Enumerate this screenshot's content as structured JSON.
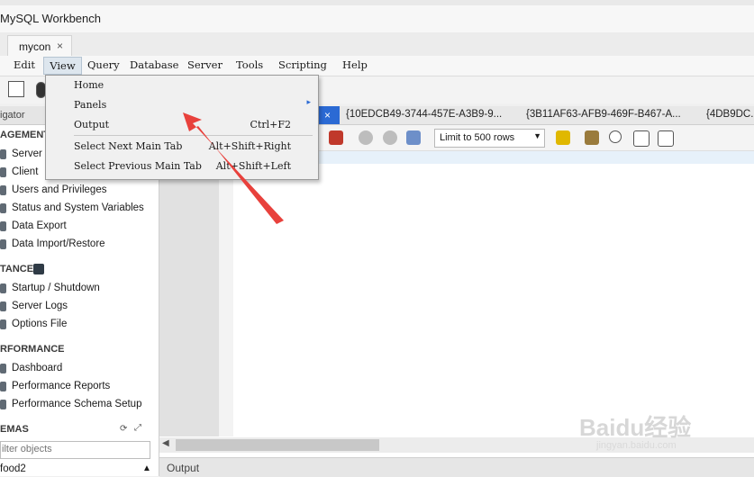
{
  "app": {
    "title": "MySQL Workbench",
    "connection_tab": "mycon",
    "close_glyph": "×"
  },
  "menubar": {
    "items": [
      "Edit",
      "View",
      "Query",
      "Database",
      "Server",
      "Tools",
      "Scripting",
      "Help"
    ],
    "active": "View"
  },
  "view_menu": {
    "items": [
      {
        "label": "Home",
        "shortcut": ""
      },
      {
        "label": "Panels",
        "shortcut": "",
        "submenu": "▸"
      },
      {
        "label": "Output",
        "shortcut": "Ctrl+F2"
      },
      {
        "label": "Select Next Main Tab",
        "shortcut": "Alt+Shift+Right"
      },
      {
        "label": "Select Previous Main Tab",
        "shortcut": "Alt+Shift+Left"
      }
    ]
  },
  "navigator": {
    "header": "igator",
    "management_section": "AGEMENT",
    "management_items": [
      "Server",
      "Client",
      "Users and Privileges",
      "Status and System Variables",
      "Data Export",
      "Data Import/Restore"
    ],
    "instance_section": "TANCE",
    "instance_items": [
      "Startup / Shutdown",
      "Server Logs",
      "Options File"
    ],
    "performance_section": "RFORMANCE",
    "performance_items": [
      "Dashboard",
      "Performance Reports",
      "Performance Schema Setup"
    ],
    "schemas_section": "EMAS",
    "filter_placeholder": "ilter objects",
    "schema_item": "food2"
  },
  "query_tabs": {
    "active_close": "×",
    "others": [
      "{10EDCB49-3744-457E-A3B9-9...",
      "{3B11AF63-AFB9-469F-B467-A...",
      "{4DB9DC..."
    ]
  },
  "query_toolbar": {
    "limit": "Limit to 500 rows"
  },
  "output_panel": {
    "label": "Output"
  },
  "watermark": {
    "brand": "Baidu经验",
    "url": "jingyan.baidu.com"
  },
  "colors": {
    "accent": "#2b6ad4",
    "arrow": "#e8413c"
  }
}
